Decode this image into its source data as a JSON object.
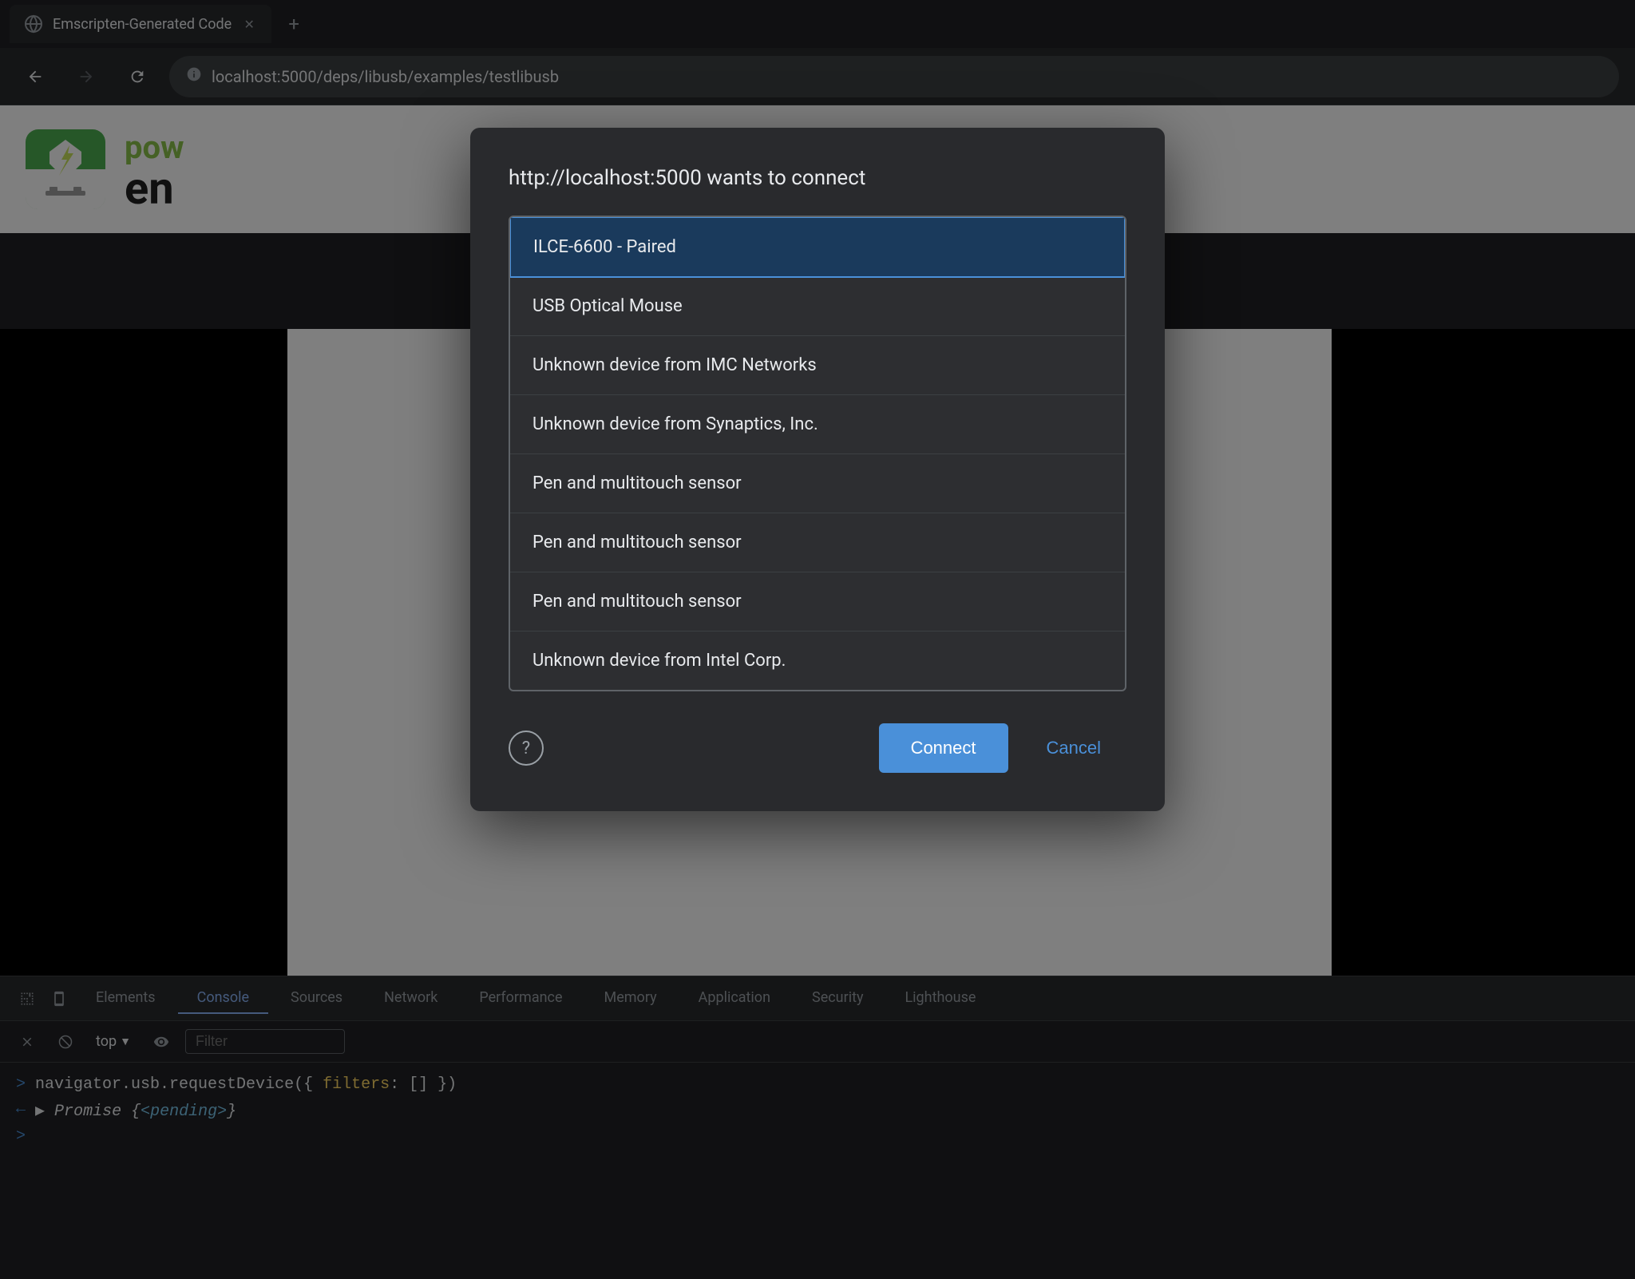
{
  "browser": {
    "tab_title": "Emscripten-Generated Code",
    "tab_favicon": "globe",
    "address": "localhost:5000/deps/libusb/examples/testlibusb",
    "address_full": "localhost:5000/deps/libusb/examples/testlibusb"
  },
  "dialog": {
    "title": "http://localhost:5000 wants to connect",
    "devices": [
      {
        "id": 0,
        "name": "ILCE-6600 - Paired",
        "selected": true
      },
      {
        "id": 1,
        "name": "USB Optical Mouse",
        "selected": false
      },
      {
        "id": 2,
        "name": "Unknown device from IMC Networks",
        "selected": false
      },
      {
        "id": 3,
        "name": "Unknown device from Synaptics, Inc.",
        "selected": false
      },
      {
        "id": 4,
        "name": "Pen and multitouch sensor",
        "selected": false
      },
      {
        "id": 5,
        "name": "Pen and multitouch sensor",
        "selected": false
      },
      {
        "id": 6,
        "name": "Pen and multitouch sensor",
        "selected": false
      },
      {
        "id": 7,
        "name": "Unknown device from Intel Corp.",
        "selected": false
      }
    ],
    "connect_label": "Connect",
    "cancel_label": "Cancel"
  },
  "devtools": {
    "tabs": [
      {
        "id": "elements",
        "label": "Elements",
        "active": false
      },
      {
        "id": "console",
        "label": "Console",
        "active": true
      },
      {
        "id": "sources",
        "label": "Sources",
        "active": false
      },
      {
        "id": "network",
        "label": "Network",
        "active": false
      },
      {
        "id": "performance",
        "label": "Performance",
        "active": false
      },
      {
        "id": "memory",
        "label": "Memory",
        "active": false
      },
      {
        "id": "application",
        "label": "Application",
        "active": false
      },
      {
        "id": "security",
        "label": "Security",
        "active": false
      },
      {
        "id": "lighthouse",
        "label": "Lighthouse",
        "active": false
      }
    ],
    "toolbar": {
      "context": "top",
      "filter_placeholder": "Filter"
    },
    "console_lines": [
      {
        "type": "input",
        "arrow": ">",
        "parts": [
          {
            "text": "navigator.usb.requestDevice(",
            "color": "white"
          },
          {
            "text": "{",
            "color": "white"
          },
          {
            "text": " filters",
            "color": "yellow"
          },
          {
            "text": ":",
            "color": "white"
          },
          {
            "text": " []",
            "color": "white"
          },
          {
            "text": " }",
            "color": "white"
          },
          {
            "text": ")",
            "color": "white"
          }
        ]
      },
      {
        "type": "output",
        "arrow": "←",
        "parts": [
          {
            "text": "▶ Promise {",
            "color": "white",
            "italic": true
          },
          {
            "text": "<pending>",
            "color": "cyan",
            "italic": true
          },
          {
            "text": "}",
            "color": "white",
            "italic": true
          }
        ]
      }
    ],
    "prompt_arrow": ">"
  },
  "app": {
    "name_pow": "pow",
    "name_en": "en"
  }
}
